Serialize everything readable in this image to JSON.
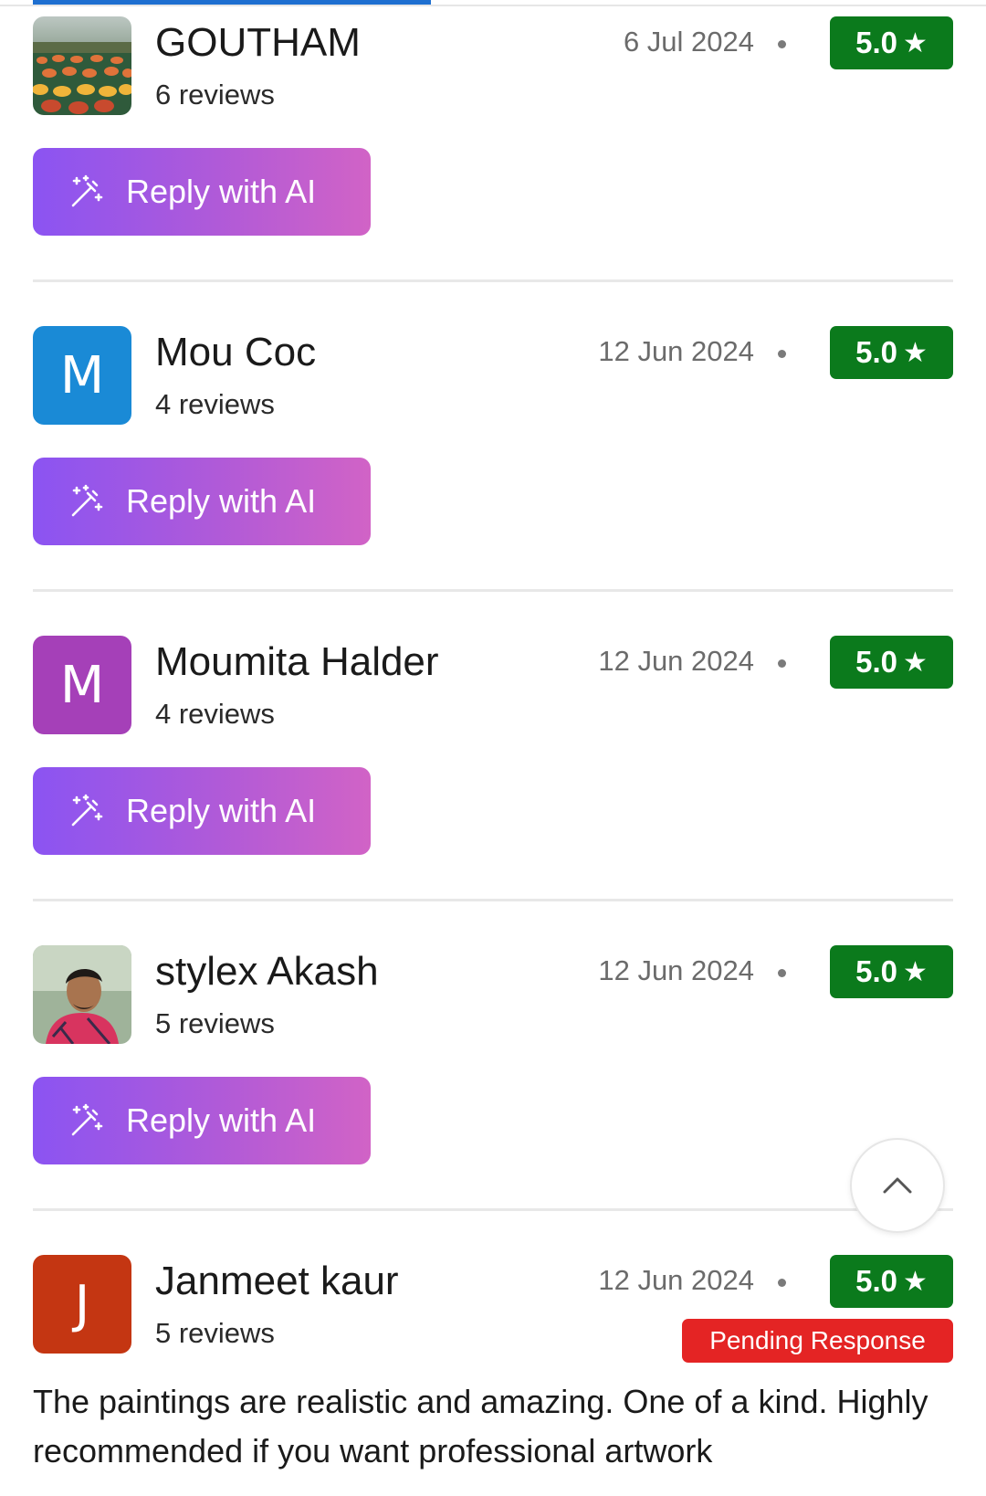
{
  "colors": {
    "accent": "#1e6fd0",
    "rating_green": "#0b7a1c",
    "button_gradient_start": "#8b54f2",
    "button_gradient_end": "#d163c6",
    "pending_red": "#e42424"
  },
  "reviews": [
    {
      "name": "GOUTHAM",
      "count": "6 reviews",
      "date": "6 Jul 2024",
      "rating": "5.0",
      "reply_label": "Reply with AI",
      "avatar": "photo-tulip-field"
    },
    {
      "name": "Mou Coc",
      "count": "4 reviews",
      "date": "12 Jun 2024",
      "rating": "5.0",
      "reply_label": "Reply with AI",
      "avatar_letter": "M",
      "avatar_color": "#1a8ad6"
    },
    {
      "name": "Moumita Halder",
      "count": "4 reviews",
      "date": "12 Jun 2024",
      "rating": "5.0",
      "reply_label": "Reply with AI",
      "avatar_letter": "M",
      "avatar_color": "#a540b8"
    },
    {
      "name": "stylex Akash",
      "count": "5 reviews",
      "date": "12 Jun 2024",
      "rating": "5.0",
      "reply_label": "Reply with AI",
      "avatar": "photo-person"
    },
    {
      "name": "Janmeet kaur",
      "count": "5 reviews",
      "date": "12 Jun 2024",
      "rating": "5.0",
      "avatar_letter": "J",
      "avatar_color": "#c43612",
      "status": "Pending Response",
      "text": "The paintings are realistic and amazing. One of a kind. Highly recommended if you want professional artwork"
    }
  ],
  "icons": {
    "rating": "star-icon",
    "reply": "magic-wand-icon",
    "scroll": "chevron-up-icon"
  }
}
